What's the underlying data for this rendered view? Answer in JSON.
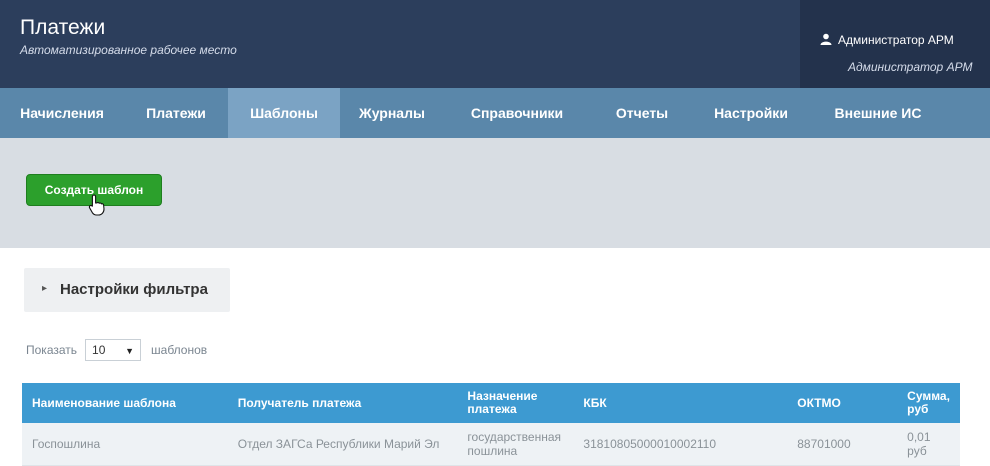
{
  "header": {
    "title": "Платежи",
    "subtitle": "Автоматизированное рабочее место",
    "user_role": "Администратор АРМ",
    "user_name": "Администратор АРМ"
  },
  "nav": {
    "items": [
      {
        "label": "Начисления"
      },
      {
        "label": "Платежи"
      },
      {
        "label": "Шаблоны"
      },
      {
        "label": "Журналы"
      },
      {
        "label": "Справочники"
      },
      {
        "label": "Отчеты"
      },
      {
        "label": "Настройки"
      },
      {
        "label": "Внешние ИС"
      }
    ],
    "active_index": 2
  },
  "toolbar": {
    "create_label": "Создать шаблон"
  },
  "filter": {
    "label": "Настройки фильтра",
    "arrow_icon": "triangle-right-icon"
  },
  "pagination": {
    "show_label": "Показать",
    "page_size": "10",
    "suffix": "шаблонов"
  },
  "table": {
    "columns": [
      "Наименование шаблона",
      "Получатель платежа",
      "Назначение платежа",
      "КБК",
      "ОКТМО",
      "Сумма, руб"
    ],
    "rows": [
      [
        "Госпошлина",
        "Отдел ЗАГСа Республики Марий Эл",
        "государственная пошлина",
        "31810805000010002110",
        "88701000",
        "0,01 руб"
      ]
    ]
  },
  "colors": {
    "header_bg": "#2c3e5c",
    "nav_bg": "#5a87aa",
    "nav_active": "#7ba3c4",
    "create_button": "#2ca02c",
    "table_header": "#3d9ad1"
  }
}
